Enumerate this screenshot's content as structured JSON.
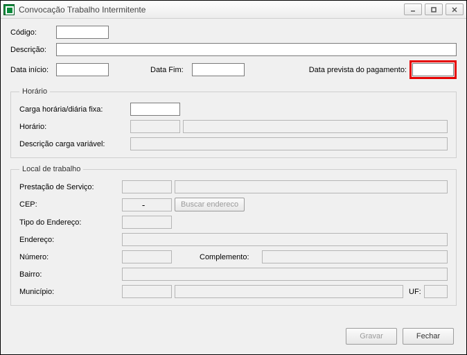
{
  "window": {
    "title": "Convocação Trabalho Intermitente"
  },
  "top": {
    "codigo_label": "Código:",
    "codigo_value": "",
    "descricao_label": "Descrição:",
    "descricao_value": "",
    "data_inicio_label": "Data início:",
    "data_inicio_value": "",
    "data_fim_label": "Data Fim:",
    "data_fim_value": "",
    "data_prev_pag_label": "Data prevista do pagamento:",
    "data_prev_pag_value": ""
  },
  "horario": {
    "legend": "Horário",
    "carga_fixa_label": "Carga horária/diária fixa:",
    "carga_fixa_value": "",
    "horario_label": "Horário:",
    "horario_value": "",
    "horario_desc_value": "",
    "carga_var_label": "Descrição carga variável:",
    "carga_var_value": ""
  },
  "local": {
    "legend": "Local de trabalho",
    "prestacao_label": "Prestação de Serviço:",
    "prestacao_value": "",
    "prestacao_desc_value": "",
    "cep_label": "CEP:",
    "cep_value": "       -",
    "buscar_label": "Buscar endereco",
    "tipo_end_label": "Tipo do Endereço:",
    "tipo_end_value": "",
    "endereco_label": "Endereço:",
    "endereco_value": "",
    "numero_label": "Número:",
    "numero_value": "",
    "complemento_label": "Complemento:",
    "complemento_value": "",
    "bairro_label": "Bairro:",
    "bairro_value": "",
    "municipio_label": "Município:",
    "municipio_code": "",
    "municipio_nome": "",
    "uf_label": "UF:",
    "uf_value": ""
  },
  "footer": {
    "gravar": "Gravar",
    "fechar": "Fechar"
  }
}
